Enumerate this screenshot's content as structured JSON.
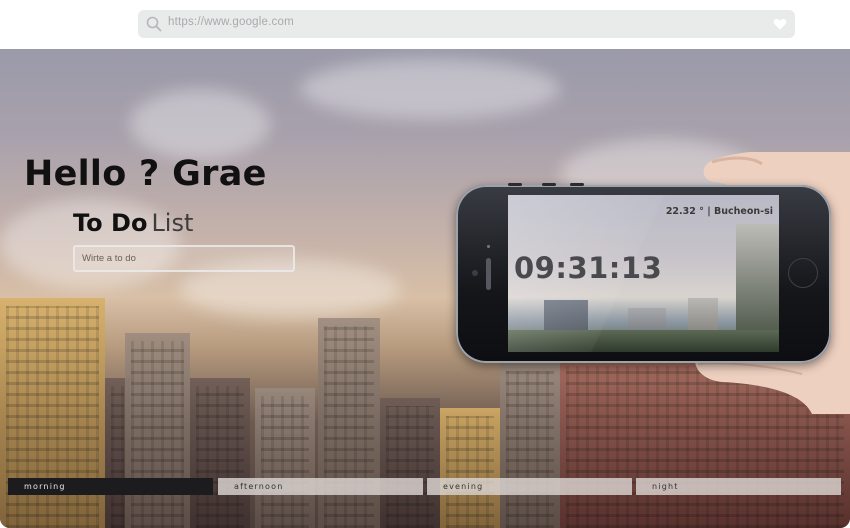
{
  "browser": {
    "url": "https://www.google.com",
    "search_icon": "search-icon",
    "favorite_icon": "heart-icon"
  },
  "greeting": "Hello ? Grae",
  "todo": {
    "title_bold": "To Do",
    "title_light": "List",
    "input_placeholder": "Wirte a to do"
  },
  "phone": {
    "weather": "22.32 ° | Bucheon-si",
    "time": "09:31:13"
  },
  "tabs": [
    {
      "label": "morning",
      "active": true
    },
    {
      "label": "afternoon",
      "active": false
    },
    {
      "label": "evening",
      "active": false
    },
    {
      "label": "night",
      "active": false
    }
  ],
  "colors": {
    "active_tab": "#1c1c1e",
    "inactive_tab": "#dcd6d2",
    "url_bar": "#e9eaea"
  }
}
